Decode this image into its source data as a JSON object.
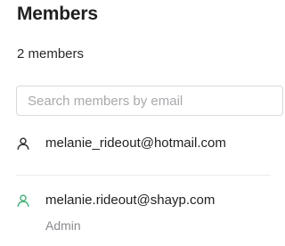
{
  "header": {
    "title": "Members",
    "member_count": "2 members"
  },
  "search": {
    "placeholder": "Search members by email",
    "value": ""
  },
  "members": [
    {
      "email": "melanie_rideout@hotmail.com",
      "role": "",
      "icon": "user-icon",
      "icon_color": "#2b2b2b"
    },
    {
      "email": "melanie.rideout@shayp.com",
      "role": "Admin",
      "icon": "user-icon",
      "icon_color": "#3cb371"
    }
  ],
  "colors": {
    "admin_accent": "#3cb371",
    "divider": "#ececef",
    "muted_text": "#8a8a8f"
  }
}
